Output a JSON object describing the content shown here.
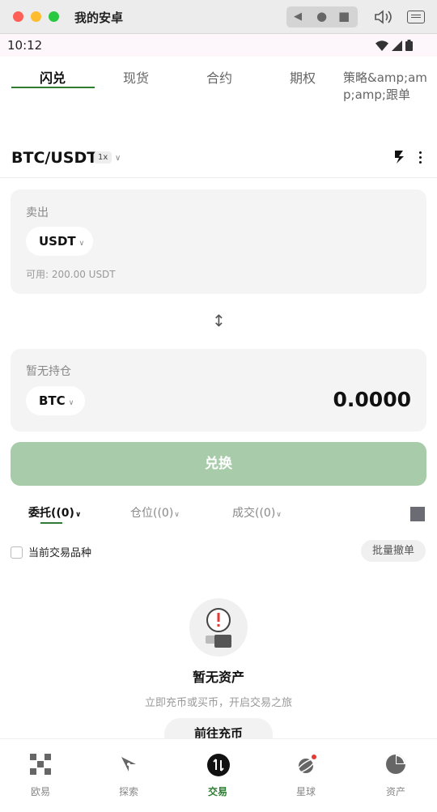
{
  "window": {
    "title": "我的安卓"
  },
  "status": {
    "time": "10:12"
  },
  "tabs": [
    {
      "label": "闪兑",
      "active": true
    },
    {
      "label": "现货"
    },
    {
      "label": "合约"
    },
    {
      "label": "期权"
    },
    {
      "label": "策略&amp;amp;amp;跟单"
    }
  ],
  "pair": {
    "name": "BTC/USDT",
    "leverage": "1x",
    "chevron": "∨"
  },
  "sell": {
    "label": "卖出",
    "coin": "USDT",
    "available": "可用: 200.00 USDT"
  },
  "receive": {
    "label": "暂无持仓",
    "coin": "BTC",
    "amount": "0.0000"
  },
  "convert_label": "兑换",
  "order_tabs": [
    {
      "label": "委托((0)",
      "active": true
    },
    {
      "label": "仓位((0)"
    },
    {
      "label": "成交((0)"
    }
  ],
  "filter": {
    "label": "当前交易品种",
    "batch_cancel": "批量撤单"
  },
  "empty": {
    "title": "暂无资产",
    "subtitle": "立即充币或买币，开启交易之旅",
    "button": "前往充币"
  },
  "bottom_nav": [
    {
      "label": "欧易",
      "icon": "okx-logo-icon"
    },
    {
      "label": "探索",
      "icon": "compass-icon"
    },
    {
      "label": "交易",
      "icon": "trade-icon",
      "active": true
    },
    {
      "label": "星球",
      "icon": "planet-icon"
    },
    {
      "label": "资产",
      "icon": "pie-icon"
    }
  ],
  "colors": {
    "accent": "#2e7d32",
    "button_disabled": "#a8cba9",
    "card_bg": "#f4f4f4"
  }
}
